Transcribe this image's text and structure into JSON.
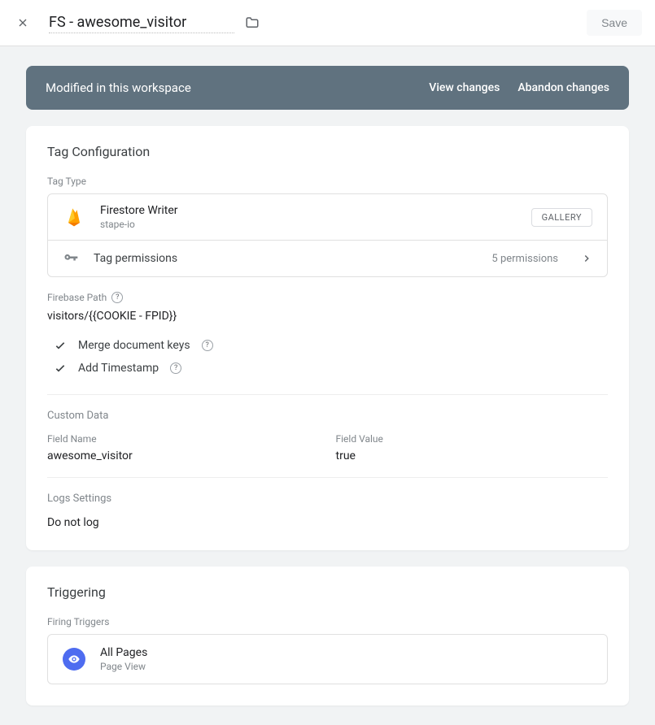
{
  "header": {
    "title": "FS - awesome_visitor",
    "save_label": "Save"
  },
  "banner": {
    "text": "Modified in this workspace",
    "view_changes": "View changes",
    "abandon_changes": "Abandon changes"
  },
  "config": {
    "title": "Tag Configuration",
    "tag_type_label": "Tag Type",
    "tag_type": {
      "name": "Firestore Writer",
      "author": "stape-io",
      "gallery_label": "GALLERY"
    },
    "permissions": {
      "label": "Tag permissions",
      "count_text": "5 permissions"
    },
    "firebase_path": {
      "label": "Firebase Path",
      "value": "visitors/{{COOKIE - FPID}}"
    },
    "options": {
      "merge": "Merge document keys",
      "timestamp": "Add Timestamp"
    },
    "custom_data": {
      "section_label": "Custom Data",
      "field_name_label": "Field Name",
      "field_value_label": "Field Value",
      "field_name": "awesome_visitor",
      "field_value": "true"
    },
    "logs": {
      "section_label": "Logs Settings",
      "value": "Do not log"
    }
  },
  "triggering": {
    "title": "Triggering",
    "section_label": "Firing Triggers",
    "trigger": {
      "name": "All Pages",
      "type": "Page View"
    }
  }
}
